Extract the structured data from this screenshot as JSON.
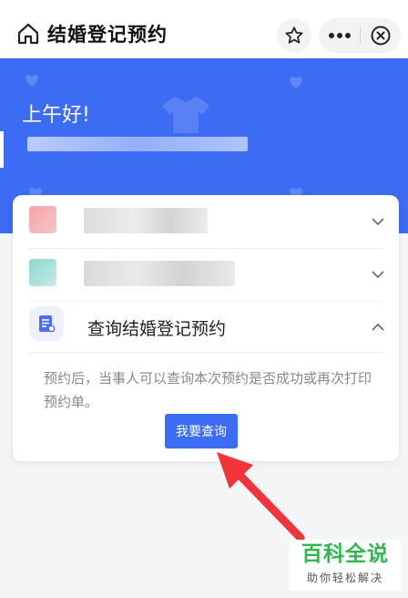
{
  "header": {
    "title": "结婚登记预约"
  },
  "hero": {
    "greeting": "上午好!"
  },
  "card": {
    "section_title": "查询结婚登记预约",
    "description": "预约后，当事人可以查询本次预约是否成功或再次打印预约单。",
    "query_button": "我要查询"
  },
  "watermark": {
    "main": "百科全说",
    "sub": "助你轻松解决"
  },
  "colors": {
    "primary": "#3c6cf4",
    "watermark_green": "#2eb84d",
    "arrow_red": "#f0343a"
  }
}
